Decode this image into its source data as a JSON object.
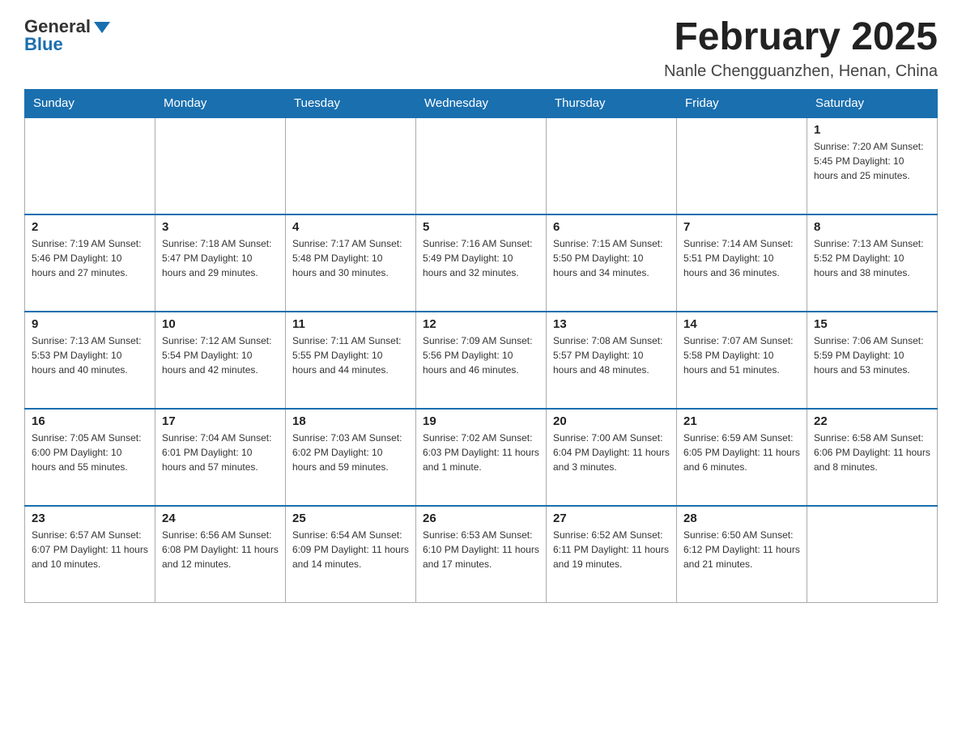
{
  "logo": {
    "general": "General",
    "blue": "Blue"
  },
  "header": {
    "month_year": "February 2025",
    "location": "Nanle Chengguanzhen, Henan, China"
  },
  "days_of_week": [
    "Sunday",
    "Monday",
    "Tuesday",
    "Wednesday",
    "Thursday",
    "Friday",
    "Saturday"
  ],
  "weeks": [
    [
      {
        "day": "",
        "info": ""
      },
      {
        "day": "",
        "info": ""
      },
      {
        "day": "",
        "info": ""
      },
      {
        "day": "",
        "info": ""
      },
      {
        "day": "",
        "info": ""
      },
      {
        "day": "",
        "info": ""
      },
      {
        "day": "1",
        "info": "Sunrise: 7:20 AM\nSunset: 5:45 PM\nDaylight: 10 hours and 25 minutes."
      }
    ],
    [
      {
        "day": "2",
        "info": "Sunrise: 7:19 AM\nSunset: 5:46 PM\nDaylight: 10 hours and 27 minutes."
      },
      {
        "day": "3",
        "info": "Sunrise: 7:18 AM\nSunset: 5:47 PM\nDaylight: 10 hours and 29 minutes."
      },
      {
        "day": "4",
        "info": "Sunrise: 7:17 AM\nSunset: 5:48 PM\nDaylight: 10 hours and 30 minutes."
      },
      {
        "day": "5",
        "info": "Sunrise: 7:16 AM\nSunset: 5:49 PM\nDaylight: 10 hours and 32 minutes."
      },
      {
        "day": "6",
        "info": "Sunrise: 7:15 AM\nSunset: 5:50 PM\nDaylight: 10 hours and 34 minutes."
      },
      {
        "day": "7",
        "info": "Sunrise: 7:14 AM\nSunset: 5:51 PM\nDaylight: 10 hours and 36 minutes."
      },
      {
        "day": "8",
        "info": "Sunrise: 7:13 AM\nSunset: 5:52 PM\nDaylight: 10 hours and 38 minutes."
      }
    ],
    [
      {
        "day": "9",
        "info": "Sunrise: 7:13 AM\nSunset: 5:53 PM\nDaylight: 10 hours and 40 minutes."
      },
      {
        "day": "10",
        "info": "Sunrise: 7:12 AM\nSunset: 5:54 PM\nDaylight: 10 hours and 42 minutes."
      },
      {
        "day": "11",
        "info": "Sunrise: 7:11 AM\nSunset: 5:55 PM\nDaylight: 10 hours and 44 minutes."
      },
      {
        "day": "12",
        "info": "Sunrise: 7:09 AM\nSunset: 5:56 PM\nDaylight: 10 hours and 46 minutes."
      },
      {
        "day": "13",
        "info": "Sunrise: 7:08 AM\nSunset: 5:57 PM\nDaylight: 10 hours and 48 minutes."
      },
      {
        "day": "14",
        "info": "Sunrise: 7:07 AM\nSunset: 5:58 PM\nDaylight: 10 hours and 51 minutes."
      },
      {
        "day": "15",
        "info": "Sunrise: 7:06 AM\nSunset: 5:59 PM\nDaylight: 10 hours and 53 minutes."
      }
    ],
    [
      {
        "day": "16",
        "info": "Sunrise: 7:05 AM\nSunset: 6:00 PM\nDaylight: 10 hours and 55 minutes."
      },
      {
        "day": "17",
        "info": "Sunrise: 7:04 AM\nSunset: 6:01 PM\nDaylight: 10 hours and 57 minutes."
      },
      {
        "day": "18",
        "info": "Sunrise: 7:03 AM\nSunset: 6:02 PM\nDaylight: 10 hours and 59 minutes."
      },
      {
        "day": "19",
        "info": "Sunrise: 7:02 AM\nSunset: 6:03 PM\nDaylight: 11 hours and 1 minute."
      },
      {
        "day": "20",
        "info": "Sunrise: 7:00 AM\nSunset: 6:04 PM\nDaylight: 11 hours and 3 minutes."
      },
      {
        "day": "21",
        "info": "Sunrise: 6:59 AM\nSunset: 6:05 PM\nDaylight: 11 hours and 6 minutes."
      },
      {
        "day": "22",
        "info": "Sunrise: 6:58 AM\nSunset: 6:06 PM\nDaylight: 11 hours and 8 minutes."
      }
    ],
    [
      {
        "day": "23",
        "info": "Sunrise: 6:57 AM\nSunset: 6:07 PM\nDaylight: 11 hours and 10 minutes."
      },
      {
        "day": "24",
        "info": "Sunrise: 6:56 AM\nSunset: 6:08 PM\nDaylight: 11 hours and 12 minutes."
      },
      {
        "day": "25",
        "info": "Sunrise: 6:54 AM\nSunset: 6:09 PM\nDaylight: 11 hours and 14 minutes."
      },
      {
        "day": "26",
        "info": "Sunrise: 6:53 AM\nSunset: 6:10 PM\nDaylight: 11 hours and 17 minutes."
      },
      {
        "day": "27",
        "info": "Sunrise: 6:52 AM\nSunset: 6:11 PM\nDaylight: 11 hours and 19 minutes."
      },
      {
        "day": "28",
        "info": "Sunrise: 6:50 AM\nSunset: 6:12 PM\nDaylight: 11 hours and 21 minutes."
      },
      {
        "day": "",
        "info": ""
      }
    ]
  ]
}
